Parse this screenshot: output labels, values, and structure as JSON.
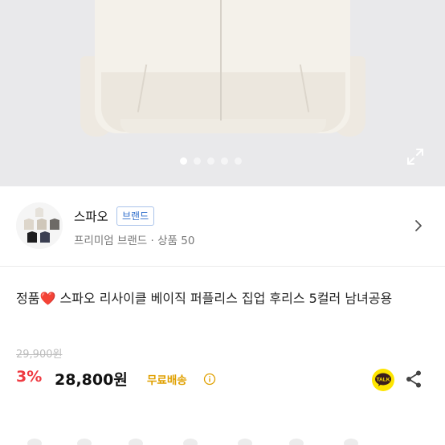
{
  "colors": {
    "accent_discount": "#ef3b42",
    "brand_badge_text": "#2f6ecb",
    "free_shipping": "#e0a000",
    "muted_text": "#777777",
    "talk_yellow": "#fee500"
  },
  "gallery": {
    "slide_count": 5,
    "active_index": 0,
    "expand_icon": "expand-icon"
  },
  "seller": {
    "name": "스파오",
    "badge": "브랜드",
    "subtitle": "프리미엄 브랜드 · 상품 50",
    "arrow_icon": "chevron-right-icon"
  },
  "product": {
    "title_prefix": "정품",
    "title_emoji": "❤️",
    "title_rest": " 스파오 리사이클 베이직 퍼플리스 집업 후리스 5컬러 남녀공용",
    "original_price": "29,900원",
    "discount": "3%",
    "price": "28,800원",
    "shipping": "무료배송"
  },
  "actions": {
    "talk_label": "TALK",
    "share_icon": "share-icon"
  }
}
